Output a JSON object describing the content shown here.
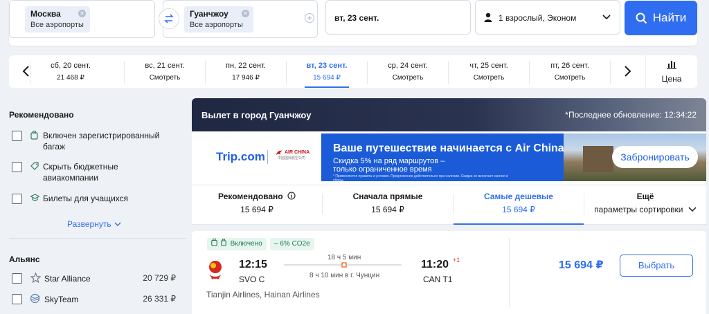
{
  "search": {
    "from_city": "Москва",
    "from_sub": "Все аэропорты",
    "to_city": "Гуанчжоу",
    "to_sub": "Все аэропорты",
    "date": "вт, 23 сент.",
    "passengers": "1 взрослый, Эконом",
    "search_label": "Найти"
  },
  "date_strip": {
    "days": [
      {
        "date": "сб, 20 сент.",
        "price": "21 468 ₽"
      },
      {
        "date": "вс, 21 сент.",
        "price": "Смотреть"
      },
      {
        "date": "пн, 22 сент.",
        "price": "17 946 ₽"
      },
      {
        "date": "вт, 23 сент.",
        "price": "15 694 ₽"
      },
      {
        "date": "ср, 24 сент.",
        "price": "Смотреть"
      },
      {
        "date": "чт, 25 сент.",
        "price": "Смотреть"
      },
      {
        "date": "пт, 26 сент.",
        "price": "Смотреть"
      }
    ],
    "active_index": 3,
    "price_chart_label": "Цена"
  },
  "sidebar": {
    "recommended_title": "Рекомендовано",
    "filters": [
      {
        "label_line1": "Включен зарегистрированный",
        "label_line2": "багаж",
        "icon": "luggage-icon"
      },
      {
        "label_line1": "Скрыть бюджетные",
        "label_line2": "авиакомпании",
        "icon": "tag-icon"
      },
      {
        "label_line1": "Билеты для учащихся",
        "label_line2": "",
        "icon": "graduation-cap-icon"
      }
    ],
    "expand_label": "Развернуть",
    "alliance_title": "Альянс",
    "alliances": [
      {
        "name": "Star Alliance",
        "price": "20 729 ₽",
        "icon": "star-alliance-icon"
      },
      {
        "name": "SkyTeam",
        "price": "26 331 ₽",
        "icon": "skyteam-icon"
      }
    ]
  },
  "banner": {
    "title": "Вылет в город Гуанчжоу",
    "updated": "*Последнее обновление: 12:34:22"
  },
  "ad": {
    "brand": "Trip.com",
    "partner_logo_top": "AIR CHINA",
    "partner_logo_bottom": "中国国际航空公司",
    "headline": "Ваше путешествие начинается с Air China",
    "sub_line1": "Скидка 5% на ряд маршрутов –",
    "sub_line2": "только ограниченное время",
    "fine_print": "* Применяются правила и условия. Предложение действительно при наличии. Скидка не включает налоги и сборы.",
    "cta": "Забронировать"
  },
  "sort": {
    "options": [
      {
        "title": "Рекомендовано",
        "value": "15 694 ₽"
      },
      {
        "title": "Сначала прямые",
        "value": "15 694 ₽"
      },
      {
        "title": "Самые дешевые",
        "value": "15 694 ₽"
      },
      {
        "title": "Ещё",
        "value": "параметры сортировки"
      }
    ],
    "active_index": 2
  },
  "ticket": {
    "badge_baggage": "Включено",
    "badge_co2": "– 6% CO2e",
    "depart_time": "12:15",
    "depart_airport": "SVO C",
    "arrive_time": "11:20",
    "arrive_day_offset": "+1",
    "arrive_airport": "CAN T1",
    "duration": "18 ч 5 мин",
    "layover": "8 ч 10 мин в г. Чунцин",
    "airlines": "Tianjin Airlines, Hainan Airlines",
    "price": "15 694 ₽",
    "choose_label": "Выбрать"
  },
  "colors": {
    "accent": "#2f6ef0",
    "background": "#eef1f5",
    "badge_green": "#1e7a52",
    "stop_marker": "#e8590c"
  }
}
